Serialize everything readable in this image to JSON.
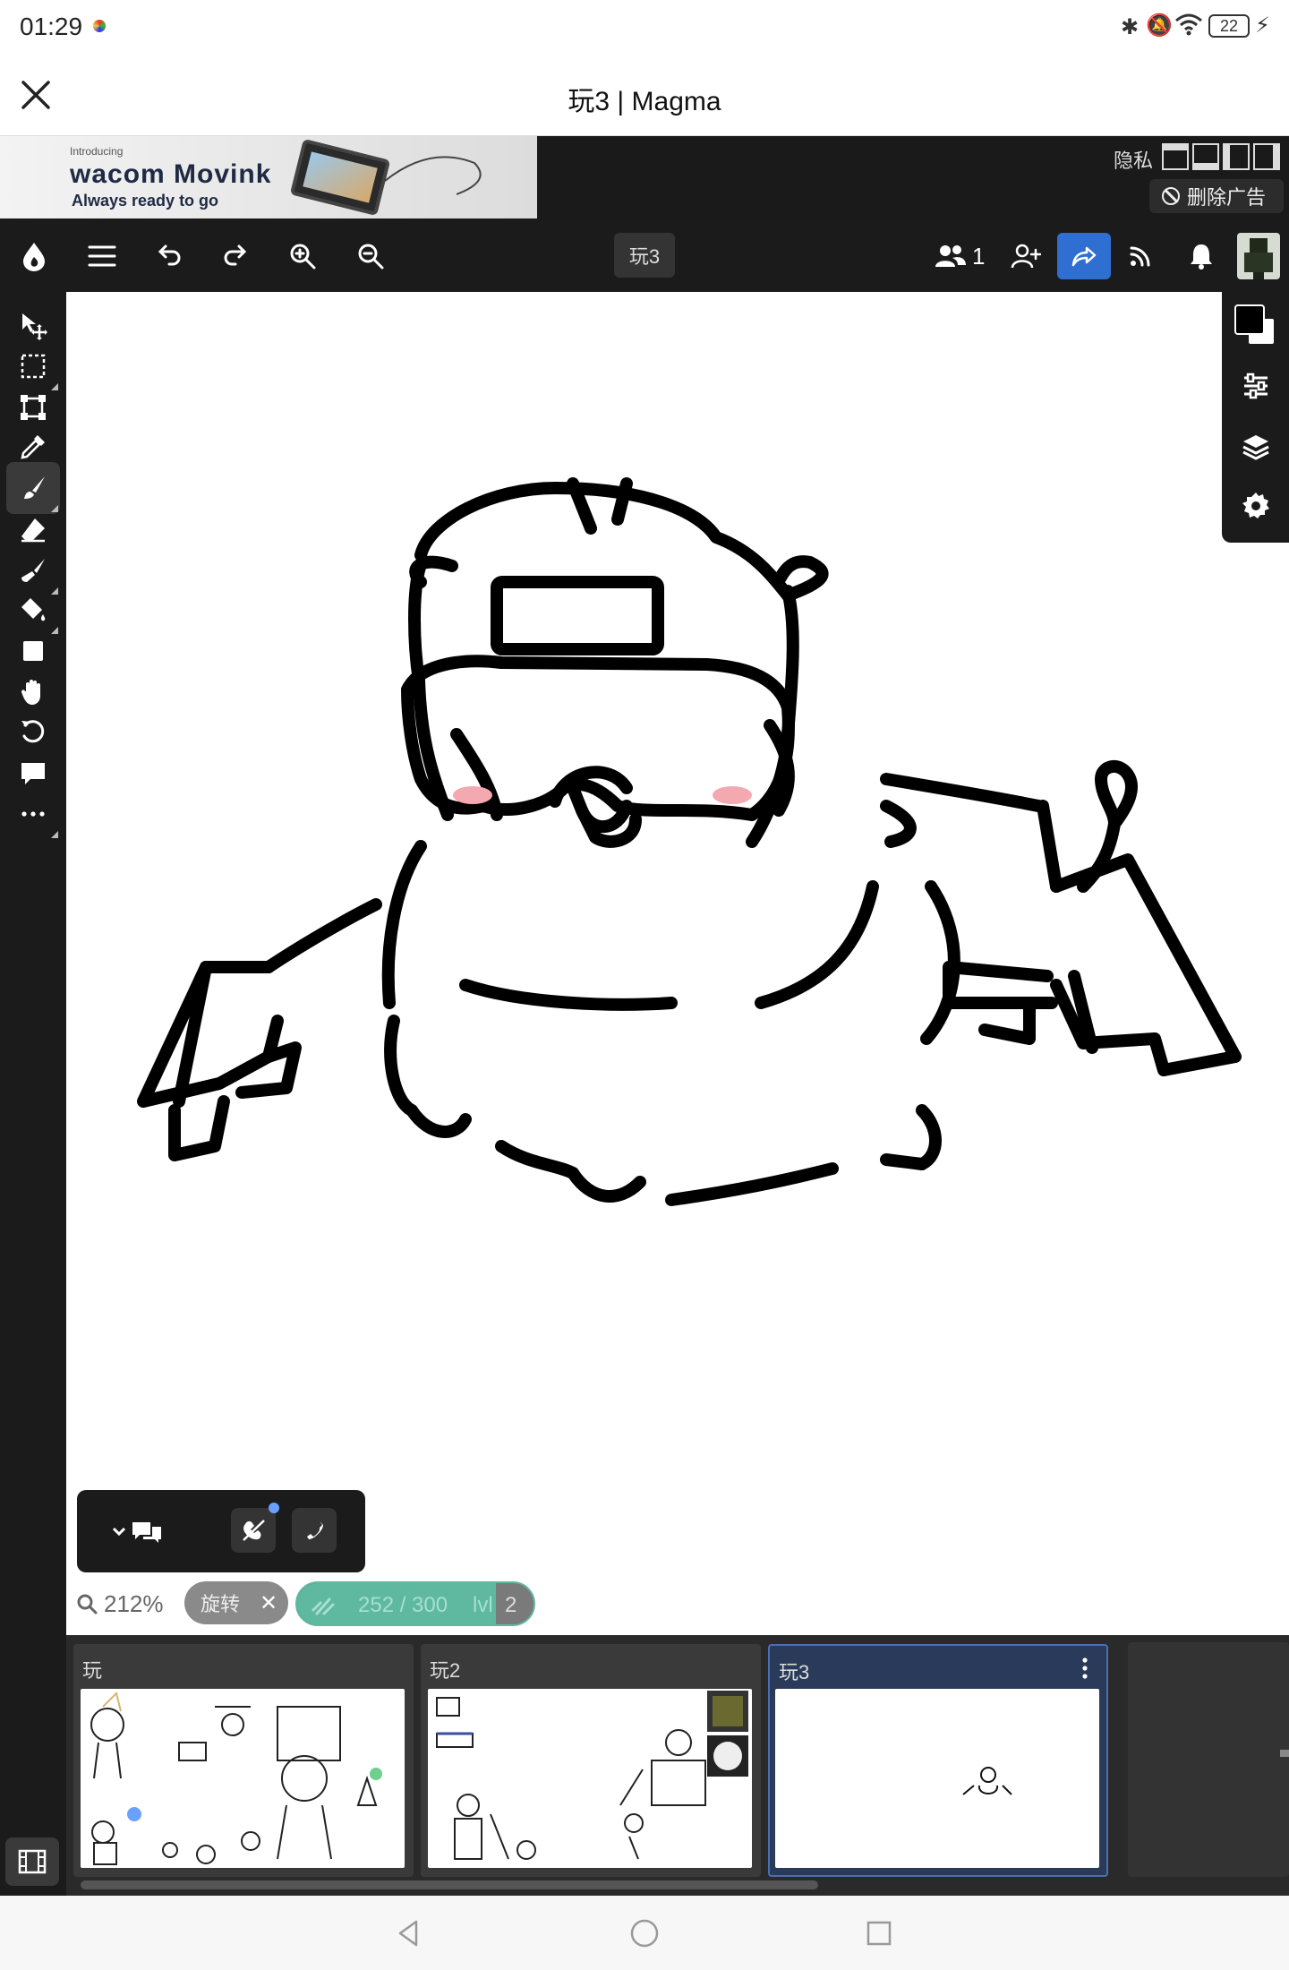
{
  "status": {
    "time": "01:29",
    "battery": "22"
  },
  "titlebar": {
    "title": "玩3 | Magma"
  },
  "ad": {
    "top_text": "Introducing",
    "brand": "wacom Movink",
    "tagline": "Always ready to go",
    "privacy_label": "隐私",
    "remove_ads_label": "删除广告"
  },
  "toolbar": {
    "drawing_name": "玩3",
    "users_count": "1"
  },
  "canvas_footer": {
    "zoom": "212%",
    "rotate_label": "旋转",
    "progress_text": "252 / 300",
    "level_prefix": "lvl",
    "level": "2",
    "progress_fraction": 0.84
  },
  "pages": [
    {
      "title": "玩"
    },
    {
      "title": "玩2"
    },
    {
      "title": "玩3"
    }
  ],
  "colors": {
    "accent": "#2f6fd1",
    "toolbar_bg": "#1b1b1b",
    "progress_fill": "#5fb8a0",
    "primary_color": "#000000",
    "secondary_color": "#ffffff"
  }
}
